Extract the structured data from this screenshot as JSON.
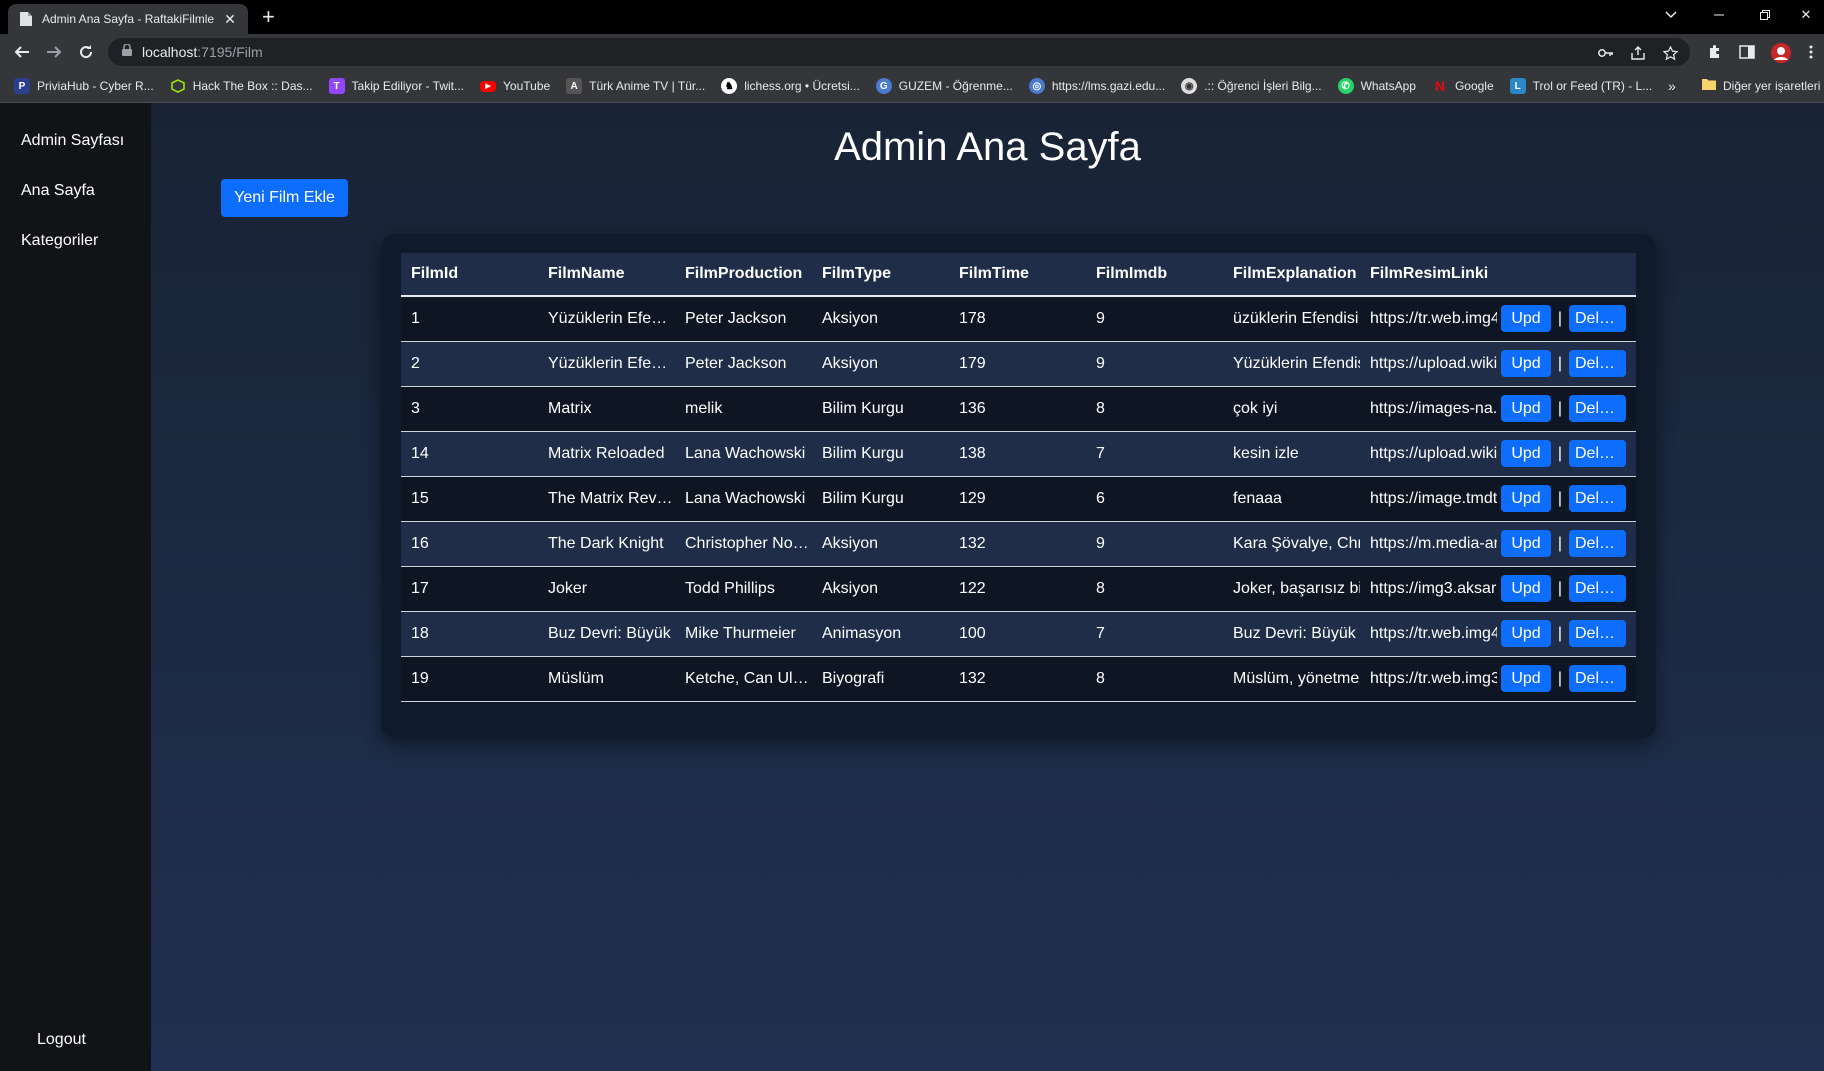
{
  "browser": {
    "tab_title": "Admin Ana Sayfa - RaftakiFilmler",
    "url_host": "localhost",
    "url_path": ":7195/Film",
    "bookmarks": [
      {
        "label": "PriviaHub - Cyber R...",
        "icon": "priviahub-icon",
        "color": "#3b5bdb"
      },
      {
        "label": "Hack The Box :: Das...",
        "icon": "hackthebox-icon",
        "color": "#9fef00"
      },
      {
        "label": "Takip Ediliyor - Twit...",
        "icon": "twitch-icon",
        "color": "#9146ff"
      },
      {
        "label": "YouTube",
        "icon": "youtube-icon",
        "color": "#ff0000"
      },
      {
        "label": "Türk Anime TV | Tür...",
        "icon": "anime-icon",
        "color": "#888888"
      },
      {
        "label": "lichess.org • Ücretsi...",
        "icon": "lichess-icon",
        "color": "#ffffff"
      },
      {
        "label": "GUZEM - Öğrenme...",
        "icon": "guzem-icon",
        "color": "#4a7bd0"
      },
      {
        "label": "https://lms.gazi.edu...",
        "icon": "globe-icon",
        "color": "#4a7bd0"
      },
      {
        "label": ".:: Öğrenci İşleri Bilg...",
        "icon": "globe-icon",
        "color": "#dddddd"
      },
      {
        "label": "WhatsApp",
        "icon": "whatsapp-icon",
        "color": "#25d366"
      },
      {
        "label": "Google",
        "icon": "netflix-icon",
        "color": "#e50914"
      },
      {
        "label": "Trol or Feed (TR) - L...",
        "icon": "league-icon",
        "color": "#2b88c8"
      }
    ],
    "other_bookmarks": "Diğer yer işaretleri"
  },
  "sidebar": {
    "items": [
      "Admin Sayfası",
      "Ana Sayfa",
      "Kategoriler"
    ],
    "logout": "Logout"
  },
  "page": {
    "title": "Admin Ana Sayfa",
    "add_button": "Yeni Film Ekle"
  },
  "table": {
    "headers": [
      "FilmId",
      "FilmName",
      "FilmProduction",
      "FilmType",
      "FilmTime",
      "FilmImdb",
      "FilmExplanation",
      "FilmResimLinki"
    ],
    "update_label": "Upd",
    "separator": "|",
    "delete_label": "Delete",
    "rows": [
      [
        "1",
        "Yüzüklerin Efendisi",
        "Peter Jackson",
        "Aksiyon",
        "178",
        "9",
        "üzüklerin Efendisi",
        "https://tr.web.img4"
      ],
      [
        "2",
        "Yüzüklerin Efendisi",
        "Peter Jackson",
        "Aksiyon",
        "179",
        "9",
        "Yüzüklerin Efendisi",
        "https://upload.wiki"
      ],
      [
        "3",
        "Matrix",
        "melik",
        "Bilim Kurgu",
        "136",
        "8",
        "çok iyi",
        "https://images-na."
      ],
      [
        "14",
        "Matrix Reloaded",
        "Lana Wachowski",
        "Bilim Kurgu",
        "138",
        "7",
        "kesin izle",
        "https://upload.wiki"
      ],
      [
        "15",
        "The Matrix Revolutions",
        "Lana Wachowski",
        "Bilim Kurgu",
        "129",
        "6",
        "fenaaa",
        "https://image.tmdt"
      ],
      [
        "16",
        "The Dark Knight",
        "Christopher Nolan",
        "Aksiyon",
        "132",
        "9",
        "Kara Şövalye, Chr",
        "https://m.media-ar"
      ],
      [
        "17",
        "Joker",
        "Todd Phillips",
        "Aksiyon",
        "122",
        "8",
        "Joker, başarısız bi",
        "https://img3.aksar"
      ],
      [
        "18",
        "Buz Devri: Büyük",
        "Mike Thurmeier",
        "Animasyon",
        "100",
        "7",
        "Buz Devri: Büyük",
        "https://tr.web.img4"
      ],
      [
        "19",
        "Müslüm",
        "Ketche, Can Ulkay",
        "Biyografi",
        "132",
        "8",
        "Müslüm, yönetme",
        "https://tr.web.img3"
      ]
    ]
  }
}
